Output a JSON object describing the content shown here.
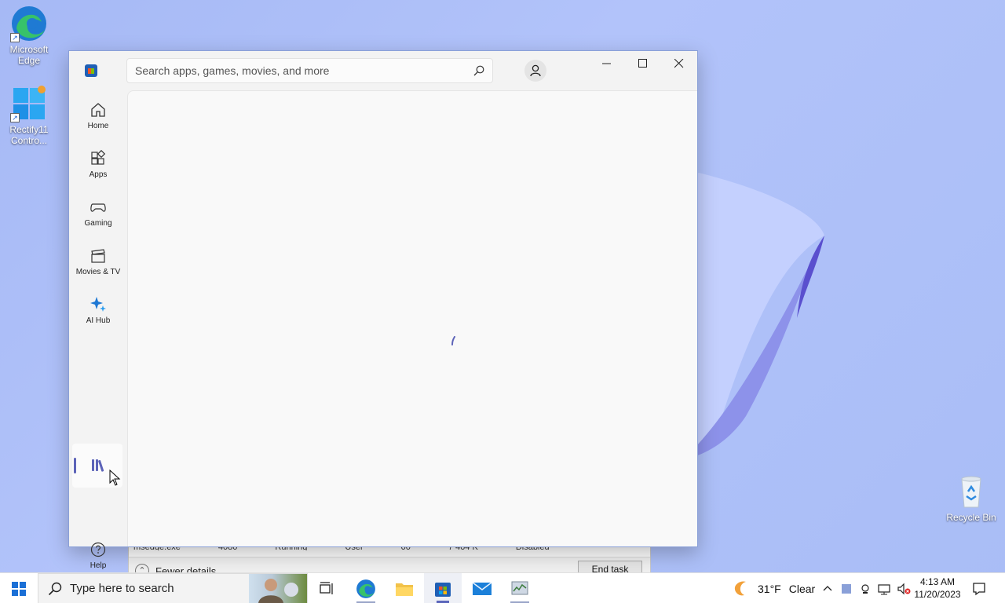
{
  "desktop": {
    "icons": [
      {
        "label": "Microsoft Edge"
      },
      {
        "label": "Rectify11 Contro..."
      },
      {
        "label": "Recycle Bin"
      }
    ]
  },
  "store": {
    "search": {
      "placeholder": "Search apps, games, movies, and more"
    },
    "nav": [
      {
        "label": "Home",
        "icon": "home-icon"
      },
      {
        "label": "Apps",
        "icon": "apps-icon"
      },
      {
        "label": "Gaming",
        "icon": "gaming-icon"
      },
      {
        "label": "Movies & TV",
        "icon": "movies-icon"
      },
      {
        "label": "AI Hub",
        "icon": "ai-hub-icon"
      }
    ],
    "library_icon": "library-icon",
    "help": {
      "label": "Help",
      "icon": "help-icon"
    },
    "loading": true
  },
  "task_manager": {
    "peek_row": [
      "msedge.exe",
      "4080",
      "Running",
      "User",
      "00",
      "7 464 K",
      "Disabled"
    ],
    "fewer_details": "Fewer details",
    "end_task": "End task"
  },
  "taskbar": {
    "search_text": "Type here to search",
    "apps": [
      "edge-icon",
      "file-explorer-icon",
      "store-icon",
      "mail-icon",
      "task-manager-icon"
    ],
    "weather": {
      "temp": "31°F",
      "condition": "Clear"
    },
    "time": "4:13 AM",
    "date": "11/20/2023"
  },
  "colors": {
    "accent": "#5c63b8",
    "edge_blue": "#1f7ad3",
    "desktop": "#a9bcf7"
  }
}
